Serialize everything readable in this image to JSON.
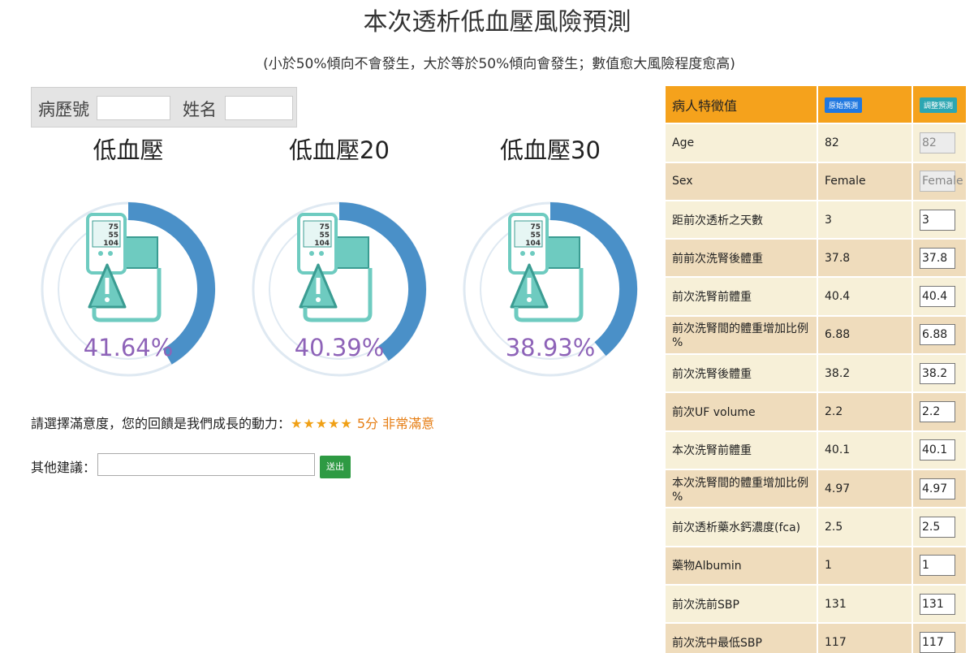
{
  "header": {
    "title": "本次透析低血壓風險預測",
    "subtitle": "(小於50%傾向不會發生，大於等於50%傾向會發生；數值愈大風險程度愈高)"
  },
  "patient": {
    "record_label": "病歷號",
    "record_value": "",
    "name_label": "姓名",
    "name_value": ""
  },
  "gauges": [
    {
      "title": "低血壓",
      "value": 41.64,
      "display": "41.64%"
    },
    {
      "title": "低血壓20",
      "value": 40.39,
      "display": "40.39%"
    },
    {
      "title": "低血壓30",
      "value": 38.93,
      "display": "38.93%"
    }
  ],
  "monitor": {
    "sys": "75",
    "dia": "55",
    "pulse": "104"
  },
  "colors": {
    "gauge_fill": "#4a90c8",
    "gauge_track": "#dfe9f2",
    "percent_text": "#8e63b8",
    "icon_teal": "#6ecbc0",
    "header_orange": "#f5a21c",
    "send_green": "#2e9a43"
  },
  "rating": {
    "prompt": "請選擇滿意度，您的回饋是我們成長的動力：",
    "stars": "★★★★★",
    "stars_count": 5,
    "score_text": "5分 非常滿意"
  },
  "suggestion": {
    "label": "其他建議：",
    "value": "",
    "send_label": "送出"
  },
  "panel": {
    "header": "病人特徵值",
    "original_button": "原始預測",
    "adjust_button": "調整預測",
    "rows": [
      {
        "name": "Age",
        "value": "82",
        "input": "82",
        "disabled": true
      },
      {
        "name": "Sex",
        "value": "Female",
        "input": "Female",
        "disabled": true
      },
      {
        "name": "距前次透析之天數",
        "value": "3",
        "input": "3"
      },
      {
        "name": "前前次洗腎後體重",
        "value": "37.8",
        "input": "37.8"
      },
      {
        "name": "前次洗腎前體重",
        "value": "40.4",
        "input": "40.4"
      },
      {
        "name": "前次洗腎間的體重增加比例 %",
        "value": "6.88",
        "input": "6.88"
      },
      {
        "name": "前次洗腎後體重",
        "value": "38.2",
        "input": "38.2"
      },
      {
        "name": "前次UF volume",
        "value": "2.2",
        "input": "2.2"
      },
      {
        "name": "本次洗腎前體重",
        "value": "40.1",
        "input": "40.1"
      },
      {
        "name": "本次洗腎間的體重增加比例 %",
        "value": "4.97",
        "input": "4.97"
      },
      {
        "name": "前次透析藥水鈣濃度(fca)",
        "value": "2.5",
        "input": "2.5"
      },
      {
        "name": "藥物Albumin",
        "value": "1",
        "input": "1"
      },
      {
        "name": "前次洗前SBP",
        "value": "131",
        "input": "131"
      },
      {
        "name": "前次洗中最低SBP",
        "value": "117",
        "input": "117"
      }
    ]
  }
}
